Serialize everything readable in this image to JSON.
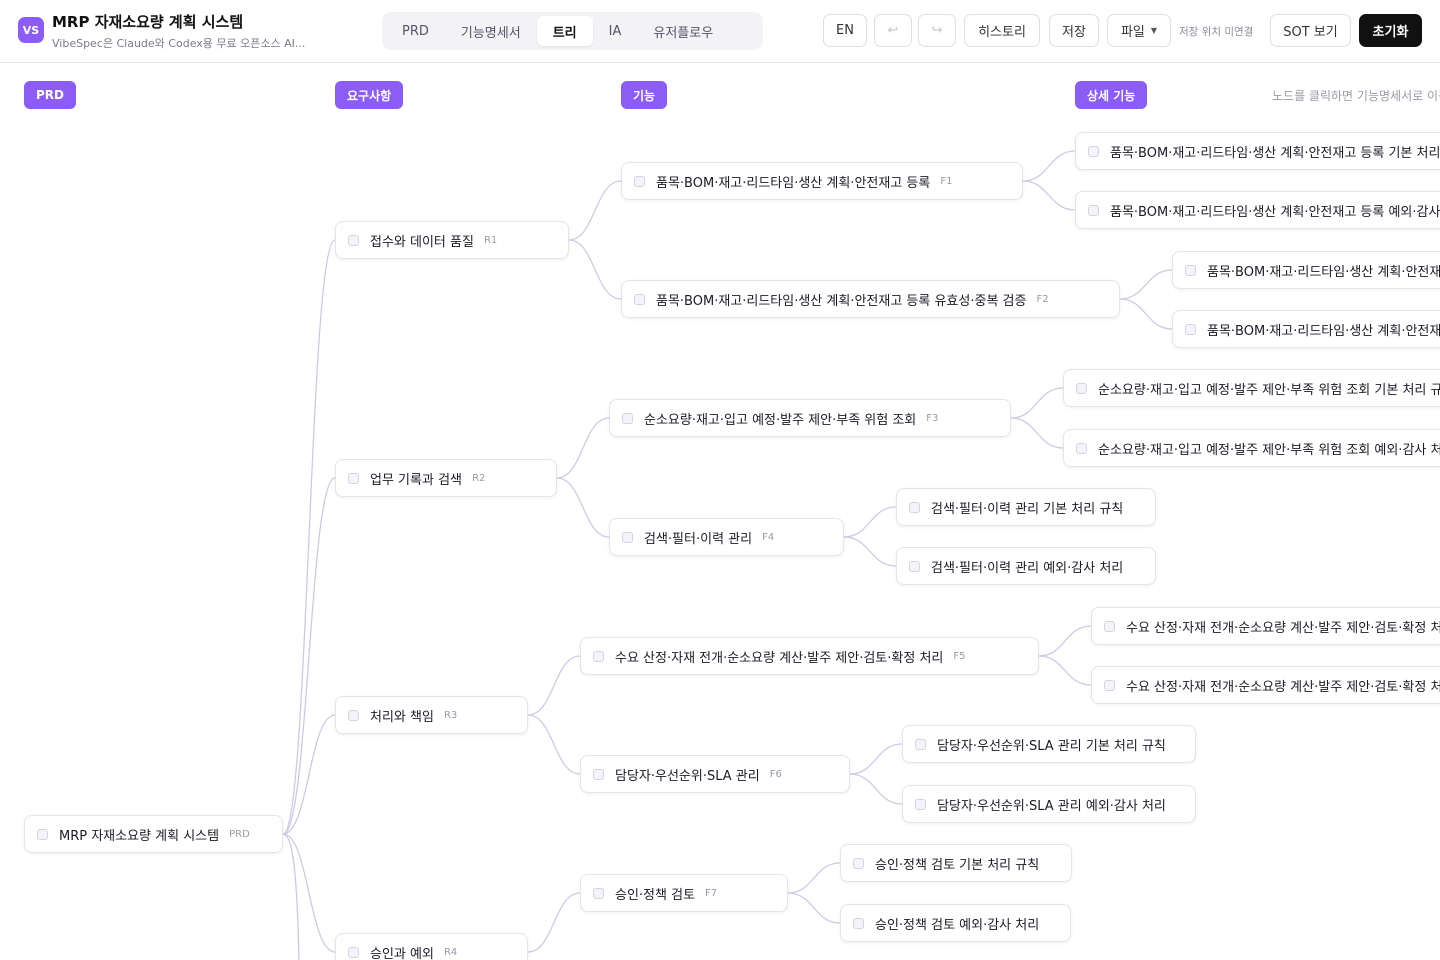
{
  "app": {
    "logo": "VS",
    "title": "MRP 자재소요량 계획 시스템",
    "subtitle": "VibeSpec은 Claude와 Codex용 무료 오픈소스 AI..."
  },
  "tabs": [
    {
      "label": "PRD",
      "active": false
    },
    {
      "label": "기능명세서",
      "active": false
    },
    {
      "label": "트리",
      "active": true
    },
    {
      "label": "IA",
      "active": false
    },
    {
      "label": "유저플로우",
      "active": false
    }
  ],
  "toolbar": {
    "lang": "EN",
    "undo_icon": "↩",
    "redo_icon": "↪",
    "history": "히스토리",
    "save": "저장",
    "file": "파일",
    "save_location": "저장 위치 미연결",
    "sot_view": "SOT 보기",
    "reset": "초기화"
  },
  "columns": {
    "prd": "PRD",
    "requirements": "요구사항",
    "features": "기능",
    "details": "상세 기능"
  },
  "hint": "노드를 클릭하면 기능명세서로 이동",
  "tree": {
    "root": {
      "label": "MRP 자재소요량 계획 시스템",
      "tag": "PRD"
    },
    "requirements": [
      {
        "label": "접수와 데이터 품질",
        "tag": "R1"
      },
      {
        "label": "업무 기록과 검색",
        "tag": "R2"
      },
      {
        "label": "처리와 책임",
        "tag": "R3"
      },
      {
        "label": "승인과 예외",
        "tag": "R4"
      }
    ],
    "features": [
      {
        "label": "품목·BOM·재고·리드타임·생산 계획·안전재고 등록",
        "tag": "F1"
      },
      {
        "label": "품목·BOM·재고·리드타임·생산 계획·안전재고 등록 유효성·중복 검증",
        "tag": "F2"
      },
      {
        "label": "순소요량·재고·입고 예정·발주 제안·부족 위험 조회",
        "tag": "F3"
      },
      {
        "label": "검색·필터·이력 관리",
        "tag": "F4"
      },
      {
        "label": "수요 산정·자재 전개·순소요량 계산·발주 제안·검토·확정 처리",
        "tag": "F5"
      },
      {
        "label": "담당자·우선순위·SLA 관리",
        "tag": "F6"
      },
      {
        "label": "승인·정책 검토",
        "tag": "F7"
      }
    ],
    "details": [
      {
        "label": "품목·BOM·재고·리드타임·생산 계획·안전재고 등록 기본 처리 규칙"
      },
      {
        "label": "품목·BOM·재고·리드타임·생산 계획·안전재고 등록 예외·감사 처리"
      },
      {
        "label": "품목·BOM·재고·리드타임·생산 계획·안전재고 등록 유효성·중복 검증 기본 처리 규칙"
      },
      {
        "label": "품목·BOM·재고·리드타임·생산 계획·안전재고 등록 유효성·중복 검증 예외·감사 처리"
      },
      {
        "label": "순소요량·재고·입고 예정·발주 제안·부족 위험 조회 기본 처리 규칙"
      },
      {
        "label": "순소요량·재고·입고 예정·발주 제안·부족 위험 조회 예외·감사 처리"
      },
      {
        "label": "검색·필터·이력 관리 기본 처리 규칙"
      },
      {
        "label": "검색·필터·이력 관리 예외·감사 처리"
      },
      {
        "label": "수요 산정·자재 전개·순소요량 계산·발주 제안·검토·확정 처리 기본 처리 규칙"
      },
      {
        "label": "수요 산정·자재 전개·순소요량 계산·발주 제안·검토·확정 처리 예외·감사 처리"
      },
      {
        "label": "담당자·우선순위·SLA 관리 기본 처리 규칙"
      },
      {
        "label": "담당자·우선순위·SLA 관리 예외·감사 처리"
      },
      {
        "label": "승인·정책 검토 기본 처리 규칙"
      },
      {
        "label": "승인·정책 검토 예외·감사 처리"
      }
    ]
  },
  "colors": {
    "accent": "#8b5cf6",
    "link": "#cfc9e6",
    "dark": "#111111"
  }
}
